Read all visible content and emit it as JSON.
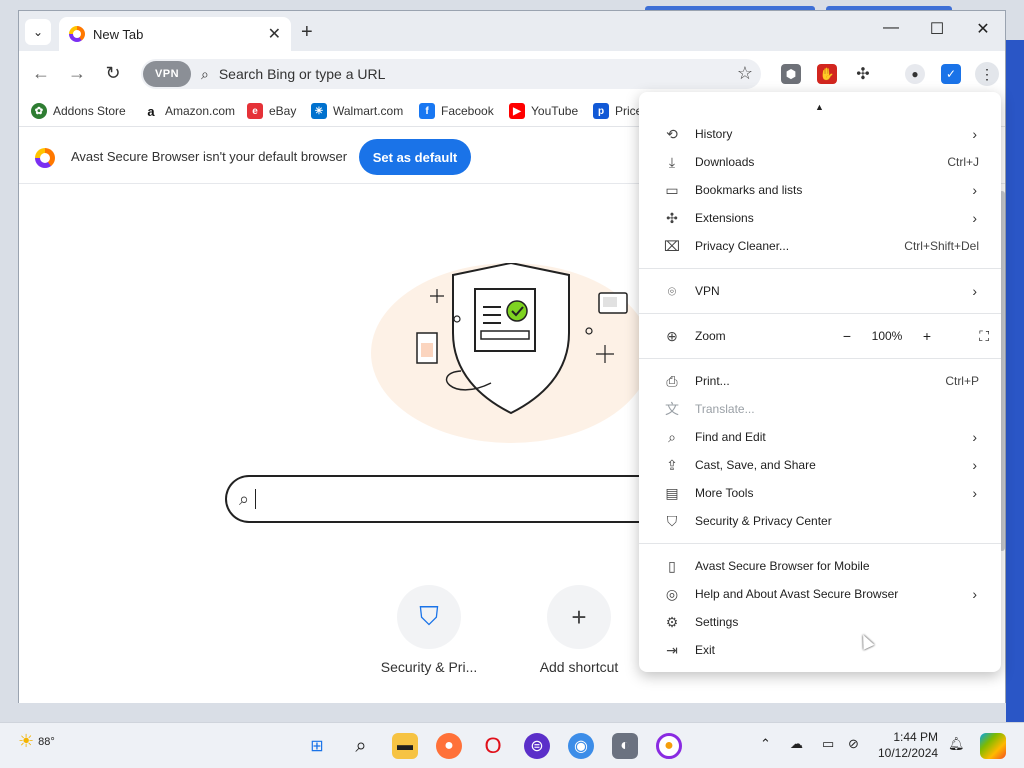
{
  "tab": {
    "title": "New Tab"
  },
  "omnibox": {
    "placeholder": "Search Bing or type a URL",
    "vpn_label": "VPN"
  },
  "bookmarks": [
    {
      "label": "Addons Store",
      "icon": "addons-store-icon",
      "color": "#2e7d32"
    },
    {
      "label": "Amazon.com",
      "icon": "amazon-icon",
      "color": "#111111"
    },
    {
      "label": "eBay",
      "icon": "ebay-icon",
      "color": "#e53238"
    },
    {
      "label": "Walmart.com",
      "icon": "walmart-icon",
      "color": "#0071ce"
    },
    {
      "label": "Facebook",
      "icon": "facebook-icon",
      "color": "#1877f2"
    },
    {
      "label": "YouTube",
      "icon": "youtube-icon",
      "color": "#ff0000"
    },
    {
      "label": "Price",
      "icon": "priceline-icon",
      "color": "#1259d6"
    }
  ],
  "infobar": {
    "message": "Avast Secure Browser isn't your default browser",
    "button": "Set as default"
  },
  "shortcuts": [
    {
      "label": "Security & Pri...",
      "icon": "shield-icon"
    },
    {
      "label": "Add shortcut",
      "icon": "plus-icon"
    }
  ],
  "menu": {
    "items": [
      {
        "label": "History",
        "icon": "history-icon",
        "glyph": "⟲",
        "shortcut": "",
        "chevron": true
      },
      {
        "label": "Downloads",
        "icon": "download-icon",
        "glyph": "⤓",
        "shortcut": "Ctrl+J",
        "chevron": false
      },
      {
        "label": "Bookmarks and lists",
        "icon": "bookmark-icon",
        "glyph": "▭",
        "shortcut": "",
        "chevron": true
      },
      {
        "label": "Extensions",
        "icon": "puzzle-icon",
        "glyph": "✣",
        "shortcut": "",
        "chevron": true
      },
      {
        "label": "Privacy Cleaner...",
        "icon": "cleaner-icon",
        "glyph": "⌧",
        "shortcut": "Ctrl+Shift+Del",
        "chevron": false
      },
      {
        "label": "VPN",
        "icon": "vpn-icon",
        "glyph": "⌾",
        "shortcut": "",
        "chevron": true
      },
      {
        "label": "Zoom",
        "icon": "zoom-icon",
        "glyph": "⊕",
        "shortcut": "",
        "chevron": false
      },
      {
        "label": "Print...",
        "icon": "print-icon",
        "glyph": "⎙",
        "shortcut": "Ctrl+P",
        "chevron": false
      },
      {
        "label": "Translate...",
        "icon": "translate-icon",
        "glyph": "文",
        "shortcut": "",
        "chevron": false,
        "disabled": true
      },
      {
        "label": "Find and Edit",
        "icon": "find-icon",
        "glyph": "⌕",
        "shortcut": "",
        "chevron": true
      },
      {
        "label": "Cast, Save, and Share",
        "icon": "cast-icon",
        "glyph": "⇪",
        "shortcut": "",
        "chevron": true
      },
      {
        "label": "More Tools",
        "icon": "toolbox-icon",
        "glyph": "▤",
        "shortcut": "",
        "chevron": true
      },
      {
        "label": "Security & Privacy Center",
        "icon": "shield-check-icon",
        "glyph": "⛉",
        "shortcut": "",
        "chevron": false
      },
      {
        "label": "Avast Secure Browser for Mobile",
        "icon": "mobile-icon",
        "glyph": "▯",
        "shortcut": "",
        "chevron": false
      },
      {
        "label": "Help and About Avast Secure Browser",
        "icon": "help-icon",
        "glyph": "◎",
        "shortcut": "",
        "chevron": true
      },
      {
        "label": "Settings",
        "icon": "gear-icon",
        "glyph": "⚙",
        "shortcut": "",
        "chevron": false
      },
      {
        "label": "Exit",
        "icon": "exit-icon",
        "glyph": "⇥",
        "shortcut": "",
        "chevron": false
      }
    ],
    "zoom": {
      "minus": "−",
      "value": "100%",
      "plus": "+",
      "fullscreen": "⛶"
    }
  },
  "taskbar": {
    "weather": "88°",
    "time": "1:44 PM",
    "date": "10/12/2024"
  }
}
